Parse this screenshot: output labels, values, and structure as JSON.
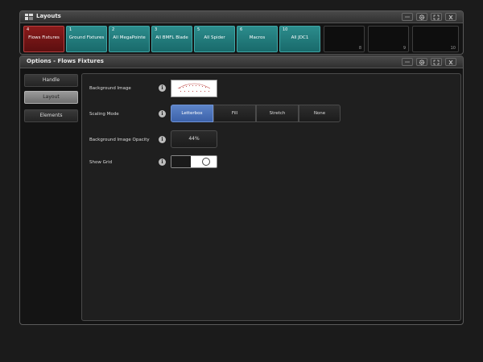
{
  "layouts_window": {
    "title": "Layouts",
    "slots": [
      {
        "num": "4",
        "label": "Flows Fixtures",
        "style": "red"
      },
      {
        "num": "1",
        "label": "Ground Fixtures",
        "style": "teal"
      },
      {
        "num": "2",
        "label": "All MegaPointe",
        "style": "teal"
      },
      {
        "num": "3",
        "label": "All BMFL Blade",
        "style": "teal"
      },
      {
        "num": "5",
        "label": "All Spider",
        "style": "teal"
      },
      {
        "num": "6",
        "label": "Macros",
        "style": "teal"
      },
      {
        "num": "10",
        "label": "All JDC1",
        "style": "teal"
      },
      {
        "num": "8",
        "label": "",
        "style": "empty"
      },
      {
        "num": "9",
        "label": "",
        "style": "empty"
      },
      {
        "num": "10",
        "label": "",
        "style": "empty"
      }
    ]
  },
  "options_window": {
    "title": "Options - Flows Fixtures",
    "sidebar": [
      {
        "label": "Handle",
        "active": false
      },
      {
        "label": "Layout",
        "active": true
      },
      {
        "label": "Elements",
        "active": false
      }
    ],
    "background_image": {
      "label": "Background Image"
    },
    "scaling_mode": {
      "label": "Scaling Mode",
      "options": [
        "Letterbox",
        "Fill",
        "Stretch",
        "None"
      ],
      "selected": "Letterbox"
    },
    "opacity": {
      "label": "Background Image Opacity",
      "value": "44%"
    },
    "show_grid": {
      "label": "Show Grid",
      "enabled": true
    }
  },
  "colors": {
    "selected_slot": "#8a1b1b",
    "layout_slot": "#2c8c8c",
    "accent_blue": "#4a72b9"
  },
  "icons": [
    "layouts-app-icon",
    "dots-icon",
    "gear-icon",
    "expand-icon",
    "close-icon",
    "info-icon"
  ]
}
